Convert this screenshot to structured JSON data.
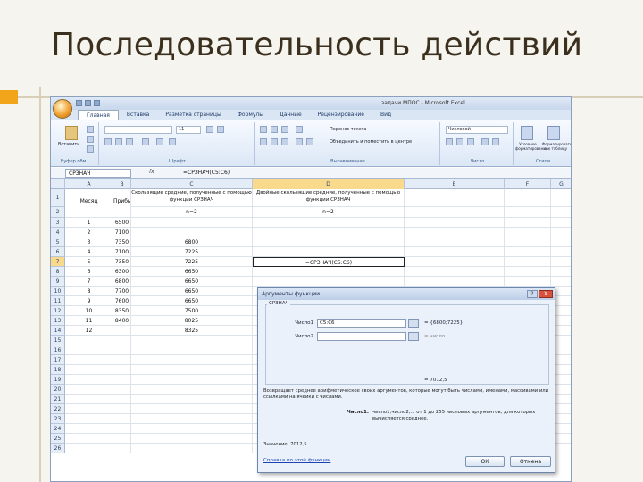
{
  "slide": {
    "title": "Последовательность действий"
  },
  "excel": {
    "window_title": "задачи МПОС - Microsoft Excel",
    "tabs": [
      "Главная",
      "Вставка",
      "Разметка страницы",
      "Формулы",
      "Данные",
      "Рецензирование",
      "Вид"
    ],
    "ribbon": {
      "paste_label": "Вставить",
      "clipboard_group": "Буфер обм...",
      "font_group": "Шрифт",
      "font_size": "11",
      "wrap_text": "Перенос текста",
      "merge_center": "Объединить и поместить в центре",
      "alignment_group": "Выравнивание",
      "number_format": "Числовой",
      "number_group": "Число",
      "cond_format": "Условное форматирование",
      "format_table": "Форматировать как таблицу",
      "styles_group": "Стили"
    },
    "namebox": "СРЗНАЧ",
    "fx": "fx",
    "formula": "=СРЗНАЧ(C5:C6)",
    "columns": [
      "A",
      "B",
      "C",
      "D",
      "E",
      "F",
      "G"
    ],
    "rows": [
      "1",
      "2",
      "3",
      "4",
      "5",
      "6",
      "7",
      "8",
      "9",
      "10",
      "11",
      "12",
      "13",
      "14",
      "15",
      "16",
      "17",
      "18",
      "19",
      "20",
      "21",
      "22",
      "23",
      "24",
      "25",
      "26"
    ],
    "header_a": "Месяц",
    "header_b": "Прибыль",
    "header_c": "Скользящие средние, полученные с помощью функции СРЗНАЧ",
    "header_d": "Двойные скользящие средние, полученные с помощью функции СРЗНАЧ",
    "sub_c": "n=2",
    "sub_d": "n=2",
    "months": [
      "1",
      "2",
      "3",
      "4",
      "5",
      "6",
      "7",
      "8",
      "9",
      "10",
      "11",
      "12"
    ],
    "profit": [
      "6500",
      "7100",
      "7350",
      "7100",
      "7350",
      "6300",
      "6800",
      "7700",
      "7600",
      "8350",
      "8400",
      ""
    ],
    "moving": [
      "",
      "",
      "6800",
      "7225",
      "7225",
      "6650",
      "6650",
      "6650",
      "6650",
      "7500",
      "8025",
      "8325"
    ],
    "active_cell": "=СРЗНАЧ(C5:C6)"
  },
  "dialog": {
    "title": "Аргументы функции",
    "help_btn": "?",
    "close_btn": "X",
    "function_name": "СРЗНАЧ",
    "arg1_label": "Число1",
    "arg1_value": "C5:C6",
    "arg1_result": "= {6800;7225}",
    "arg2_label": "Число2",
    "arg2_result": "= число",
    "result_preview": "= 7012,5",
    "description": "Возвращает среднее арифметическое своих аргументов, которые могут быть числами, именами, массивами или ссылками на ячейки с числами.",
    "arg_help_label": "Число1:",
    "arg_help": "число1;число2;... от 1 до 255 числовых аргументов, для которых вычисляется среднее.",
    "value_line": "Значение: 7012,5",
    "help_link": "Справка по этой функции",
    "ok": "ОК",
    "cancel": "Отмена"
  }
}
